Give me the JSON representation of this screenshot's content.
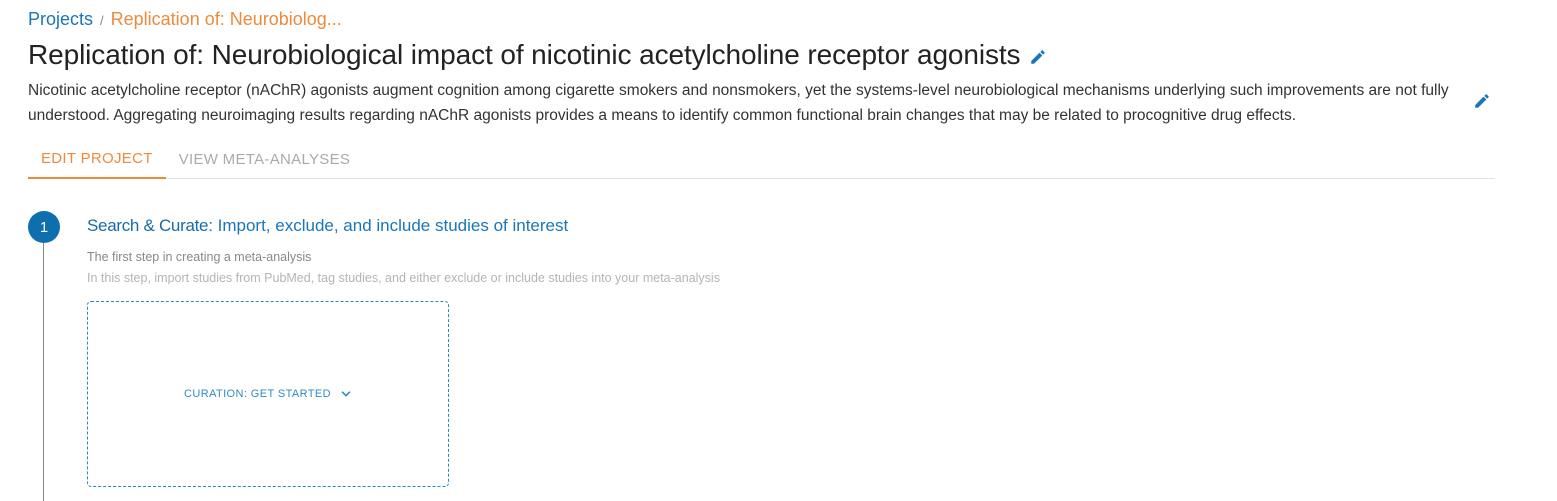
{
  "breadcrumb": {
    "projects_label": "Projects",
    "separator": "/",
    "current_label": "Replication of: Neurobiolog..."
  },
  "project": {
    "title": "Replication of: Neurobiological impact of nicotinic acetylcholine receptor agonists",
    "description": "Nicotinic acetylcholine receptor (nAChR) agonists augment cognition among cigarette smokers and nonsmokers, yet the systems-level neurobiological mechanisms underlying such improvements are not fully understood. Aggregating neuroimaging results regarding nAChR agonists provides a means to identify common functional brain changes that may be related to procognitive drug effects."
  },
  "tabs": [
    {
      "label": "EDIT PROJECT",
      "active": true
    },
    {
      "label": "VIEW META-ANALYSES",
      "active": false
    }
  ],
  "step": {
    "number": "1",
    "title_bold": "Search & Curate",
    "title_rest": ": Import, exclude, and include studies of interest",
    "subtitle": "The first step in creating a meta-analysis",
    "description": "In this step, import studies from PubMed, tag studies, and either exclude or include studies into your meta-analysis",
    "action_label": "CURATION: GET STARTED"
  },
  "icons": {
    "title_edit": "pencil-icon",
    "description_edit": "pencil-icon",
    "action_dropdown": "chevron-down-icon"
  },
  "colors": {
    "primary_blue": "#1a76b8",
    "accent_orange": "#ef8a3c",
    "step_circle": "#0d6fad"
  }
}
